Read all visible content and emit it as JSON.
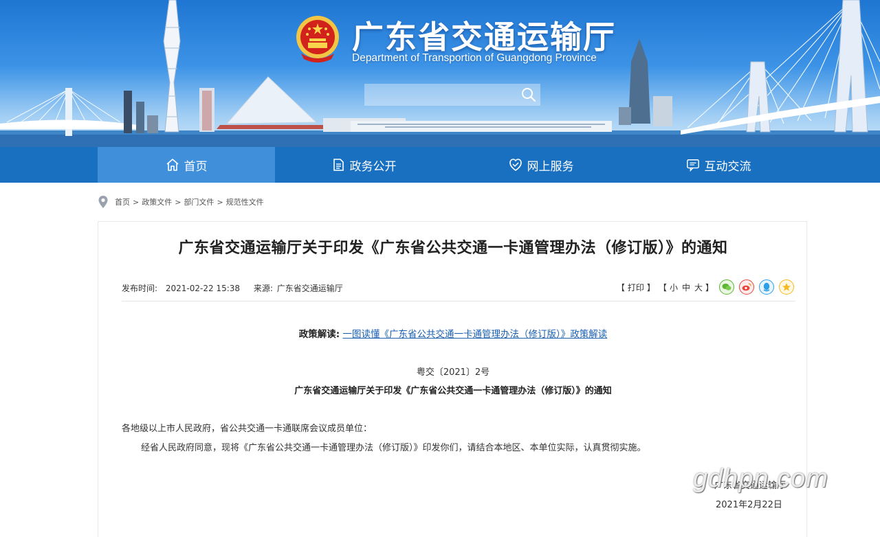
{
  "header": {
    "site_title": "广东省交通运输厅",
    "site_subtitle": "Department of Transportion of Guangdong Province",
    "search": {
      "placeholder": "",
      "value": ""
    }
  },
  "nav": {
    "items": [
      {
        "label": "首页",
        "icon": "home-icon",
        "active": true
      },
      {
        "label": "政务公开",
        "icon": "document-icon",
        "active": false
      },
      {
        "label": "网上服务",
        "icon": "service-icon",
        "active": false
      },
      {
        "label": "互动交流",
        "icon": "chat-icon",
        "active": false
      }
    ]
  },
  "breadcrumb": {
    "items": [
      "首页",
      "政策文件",
      "部门文件",
      "规范性文件"
    ],
    "separator": ">"
  },
  "article": {
    "title": "广东省交通运输厅关于印发《广东省公共交通一卡通管理办法（修订版）》的通知",
    "publish_label": "发布时间:",
    "publish_time": "2021-02-22 15:38",
    "source_label": "来源:",
    "source": "广东省交通运输厅",
    "tools": {
      "print": "打印",
      "size_small": "小",
      "size_medium": "中",
      "size_large": "大",
      "share_icons": [
        "wechat-icon",
        "weibo-icon",
        "qq-icon",
        "qzone-icon"
      ]
    },
    "policy_label": "政策解读:",
    "policy_link": "一图读懂《广东省公共交通一卡通管理办法（修订版）》政策解读",
    "doc_number": "粤交〔2021〕2号",
    "doc_title": "广东省交通运输厅关于印发《广东省公共交通一卡通管理办法（修订版）》的通知",
    "addressee": "各地级以上市人民政府，省公共交通一卡通联席会议成员单位：",
    "body": "经省人民政府同意，现将《广东省公共交通一卡通管理办法（修订版）》印发你们，请结合本地区、本单位实际，认真贯彻实施。",
    "signer": "广东省交通运输厅",
    "sign_date": "2021年2月22日"
  },
  "watermark": "gdhpn.com",
  "colors": {
    "nav_bg": "#1a70c0",
    "nav_active": "#3f8fdb",
    "link": "#1a5fb0",
    "wechat": "#5cb531",
    "weibo": "#e8463c",
    "qq": "#2b9fe8",
    "qzone": "#f5b921"
  }
}
